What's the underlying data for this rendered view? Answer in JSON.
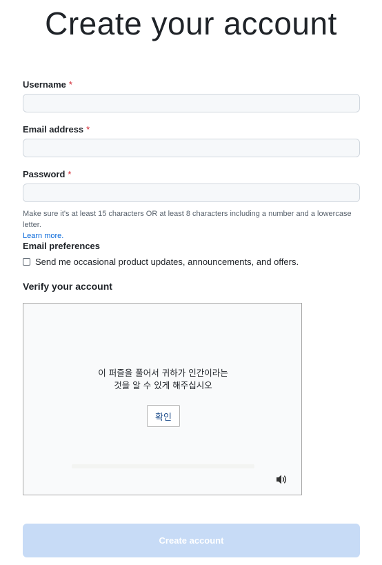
{
  "page": {
    "title": "Create your account"
  },
  "form": {
    "username": {
      "label": "Username",
      "required_mark": "*",
      "value": ""
    },
    "email": {
      "label": "Email address",
      "required_mark": "*",
      "value": ""
    },
    "password": {
      "label": "Password",
      "required_mark": "*",
      "value": "",
      "hint": "Make sure it's at least 15 characters OR at least 8 characters including a number and a lowercase letter.",
      "hint_link": "Learn more."
    },
    "preferences": {
      "label": "Email preferences",
      "checkbox_label": "Send me occasional product updates, announcements, and offers.",
      "checked": false
    }
  },
  "verify": {
    "heading": "Verify your account",
    "puzzle_line1": "이 퍼즐을 풀어서 귀하가 인간이라는",
    "puzzle_line2": "것을 알 수 있게 해주십시오",
    "confirm_label": "확인",
    "audio_icon": "speaker-icon"
  },
  "submit": {
    "label": "Create account"
  }
}
